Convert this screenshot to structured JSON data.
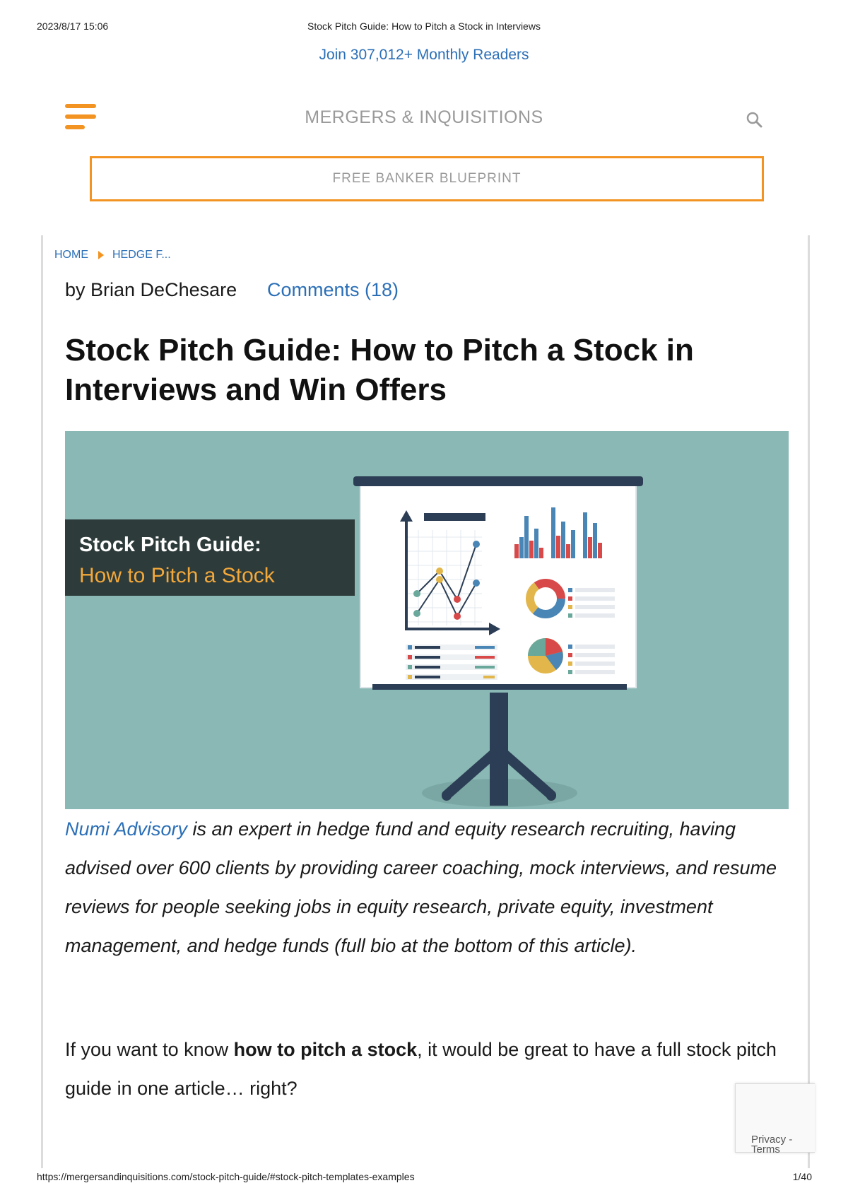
{
  "print_header": {
    "datetime": "2023/8/17 15:06",
    "title": "Stock Pitch Guide: How to Pitch a Stock in Interviews"
  },
  "join_banner": "Join 307,012+ Monthly Readers",
  "nav": {
    "site_title": "MERGERS & INQUISITIONS",
    "menu_icon": "hamburger-menu-icon",
    "search_icon": "search-icon"
  },
  "cta": {
    "label": "FREE BANKER BLUEPRINT"
  },
  "breadcrumb": {
    "home": "HOME",
    "section": "HEDGE F..."
  },
  "article": {
    "author": "by Brian DeChesare",
    "comments": "Comments (18)",
    "title": "Stock Pitch Guide: How to Pitch a Stock in Interviews and Win Offers",
    "hero": {
      "label_line1": "Stock Pitch Guide:",
      "label_line2": "How to Pitch a Stock"
    },
    "intro_link": "Numi Advisory",
    "intro_rest": " is an expert in hedge fund and equity research recruiting, having advised over 600 clients by providing career coaching, mock interviews, and resume reviews for people seeking jobs in equity research, private equity, investment management, and hedge funds (full bio at the bottom of this article).",
    "para_before": "If you want to know ",
    "para_bold": "how to pitch a stock",
    "para_after": ", it would be great to have a full stock pitch guide in one article… right?"
  },
  "recaptcha": {
    "text": "Privacy - Terms"
  },
  "print_footer": {
    "url": "https://mergersandinquisitions.com/stock-pitch-guide/#stock-pitch-templates-examples",
    "page": "1/40"
  },
  "colors": {
    "accent": "#f39321",
    "link": "#2b6fb7",
    "hero_bg": "#8ab8b4",
    "hero_label_bg": "#2d3b3a",
    "hero_subtitle": "#f3a83b"
  }
}
